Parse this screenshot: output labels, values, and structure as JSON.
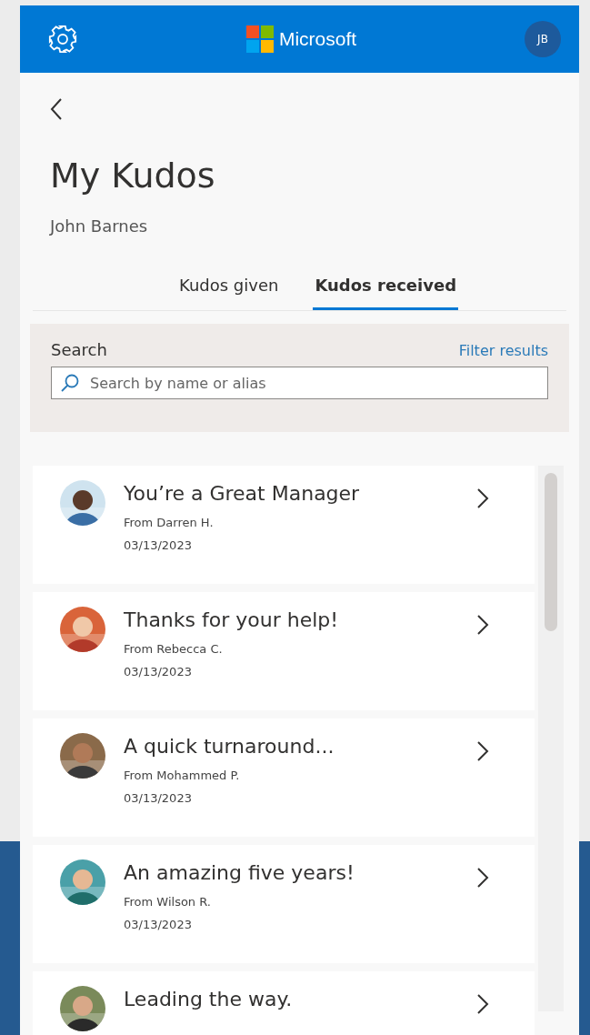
{
  "header": {
    "brand": "Microsoft",
    "avatar_initials": "JB"
  },
  "page": {
    "title": "My Kudos",
    "subtitle": "John Barnes"
  },
  "tabs": [
    {
      "label": "Kudos given",
      "selected": false
    },
    {
      "label": "Kudos received",
      "selected": true
    }
  ],
  "search": {
    "label": "Search",
    "filter_link": "Filter results",
    "placeholder": "Search by name or alias"
  },
  "kudos": [
    {
      "title": "You’re a Great Manager",
      "from": "From Darren H.",
      "date": "03/13/2023"
    },
    {
      "title": "Thanks for your help!",
      "from": "From Rebecca C.",
      "date": "03/13/2023"
    },
    {
      "title": "A quick turnaround...",
      "from": "From Mohammed P.",
      "date": "03/13/2023"
    },
    {
      "title": "An amazing five years!",
      "from": "From Wilson R.",
      "date": "03/13/2023"
    },
    {
      "title": "Leading the way."
    }
  ]
}
